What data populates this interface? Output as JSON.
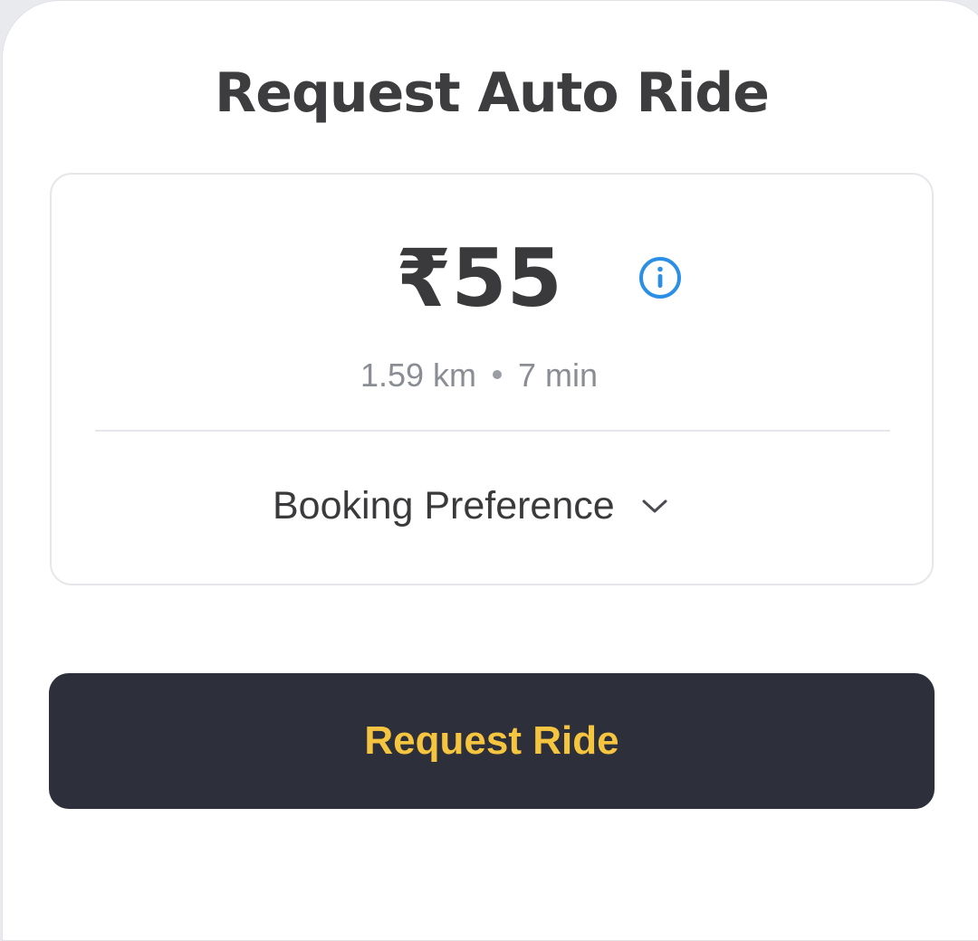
{
  "sheet": {
    "title": "Request Auto Ride"
  },
  "fare_card": {
    "fare": "₹55",
    "distance": "1.59 km",
    "duration": "7 min",
    "info_icon": "info-circle-icon",
    "booking_preference_label": "Booking Preference",
    "dropdown_icon": "chevron-down-icon"
  },
  "actions": {
    "request_label": "Request Ride"
  },
  "colors": {
    "accent_info": "#2b8fe6",
    "button_bg": "#2d2f3a",
    "button_text": "#f6c53f"
  }
}
